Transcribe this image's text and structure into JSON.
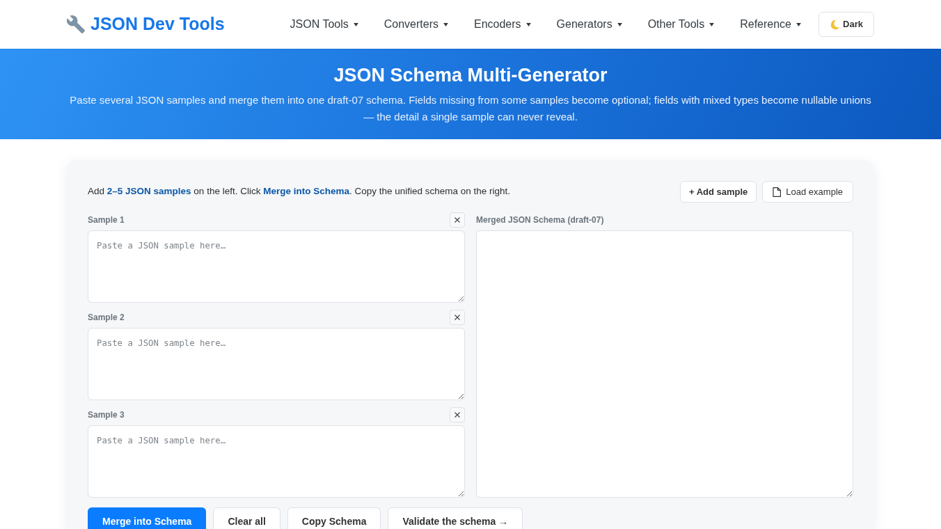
{
  "navbar": {
    "brand": "JSON Dev Tools",
    "menus": [
      {
        "label": "JSON Tools"
      },
      {
        "label": "Converters"
      },
      {
        "label": "Encoders"
      },
      {
        "label": "Generators"
      },
      {
        "label": "Other Tools"
      },
      {
        "label": "Reference"
      }
    ],
    "theme_button": "Dark"
  },
  "hero": {
    "title": "JSON Schema Multi-Generator",
    "subtitle": "Paste several JSON samples and merge them into one draft-07 schema. Fields missing from some samples become optional; fields with mixed types become nullable unions — the detail a single sample can never reveal."
  },
  "intro": "Add **2–5 JSON samples** on the left. Click **Merge into Schema**. Copy the unified schema on the right.",
  "toolbar": {
    "add_sample": "+ Add sample",
    "load_example": "Load example"
  },
  "samples": [
    {
      "label": "Sample 1",
      "placeholder": "Paste a JSON sample here…"
    },
    {
      "label": "Sample 2",
      "placeholder": "Paste a JSON sample here…"
    },
    {
      "label": "Sample 3",
      "placeholder": "Paste a JSON sample here…"
    }
  ],
  "output": {
    "label": "Merged JSON Schema (draft-07)"
  },
  "actions": [
    {
      "label": "Merge into Schema",
      "kind": "primary"
    },
    {
      "label": "Clear all",
      "kind": "outline"
    },
    {
      "label": "Copy Schema",
      "kind": "outline"
    },
    {
      "label": "Validate the schema →",
      "kind": "outline"
    }
  ]
}
